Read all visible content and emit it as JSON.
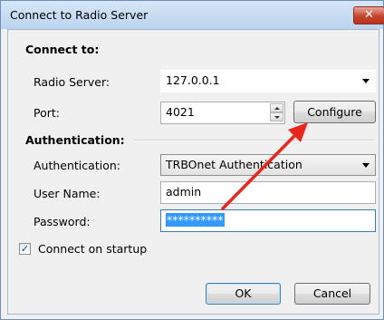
{
  "window": {
    "title": "Connect to Radio Server",
    "close_glyph": "✕"
  },
  "connect_section": {
    "heading": "Connect to:",
    "radio_server_label": "Radio Server:",
    "radio_server_value": "127.0.0.1",
    "port_label": "Port:",
    "port_value": "4021",
    "configure_label": "Configure"
  },
  "auth_section": {
    "heading": "Authentication:",
    "auth_label": "Authentication:",
    "auth_value": "TRBOnet Authentication",
    "username_label": "User Name:",
    "username_value": "admin",
    "password_label": "Password:",
    "password_value": "**********"
  },
  "options": {
    "connect_on_startup_label": "Connect on startup",
    "connect_on_startup_checked": true,
    "check_glyph": "✓"
  },
  "footer": {
    "ok_label": "OK",
    "cancel_label": "Cancel"
  },
  "annotation": {
    "arrow_color": "#e8261c"
  }
}
